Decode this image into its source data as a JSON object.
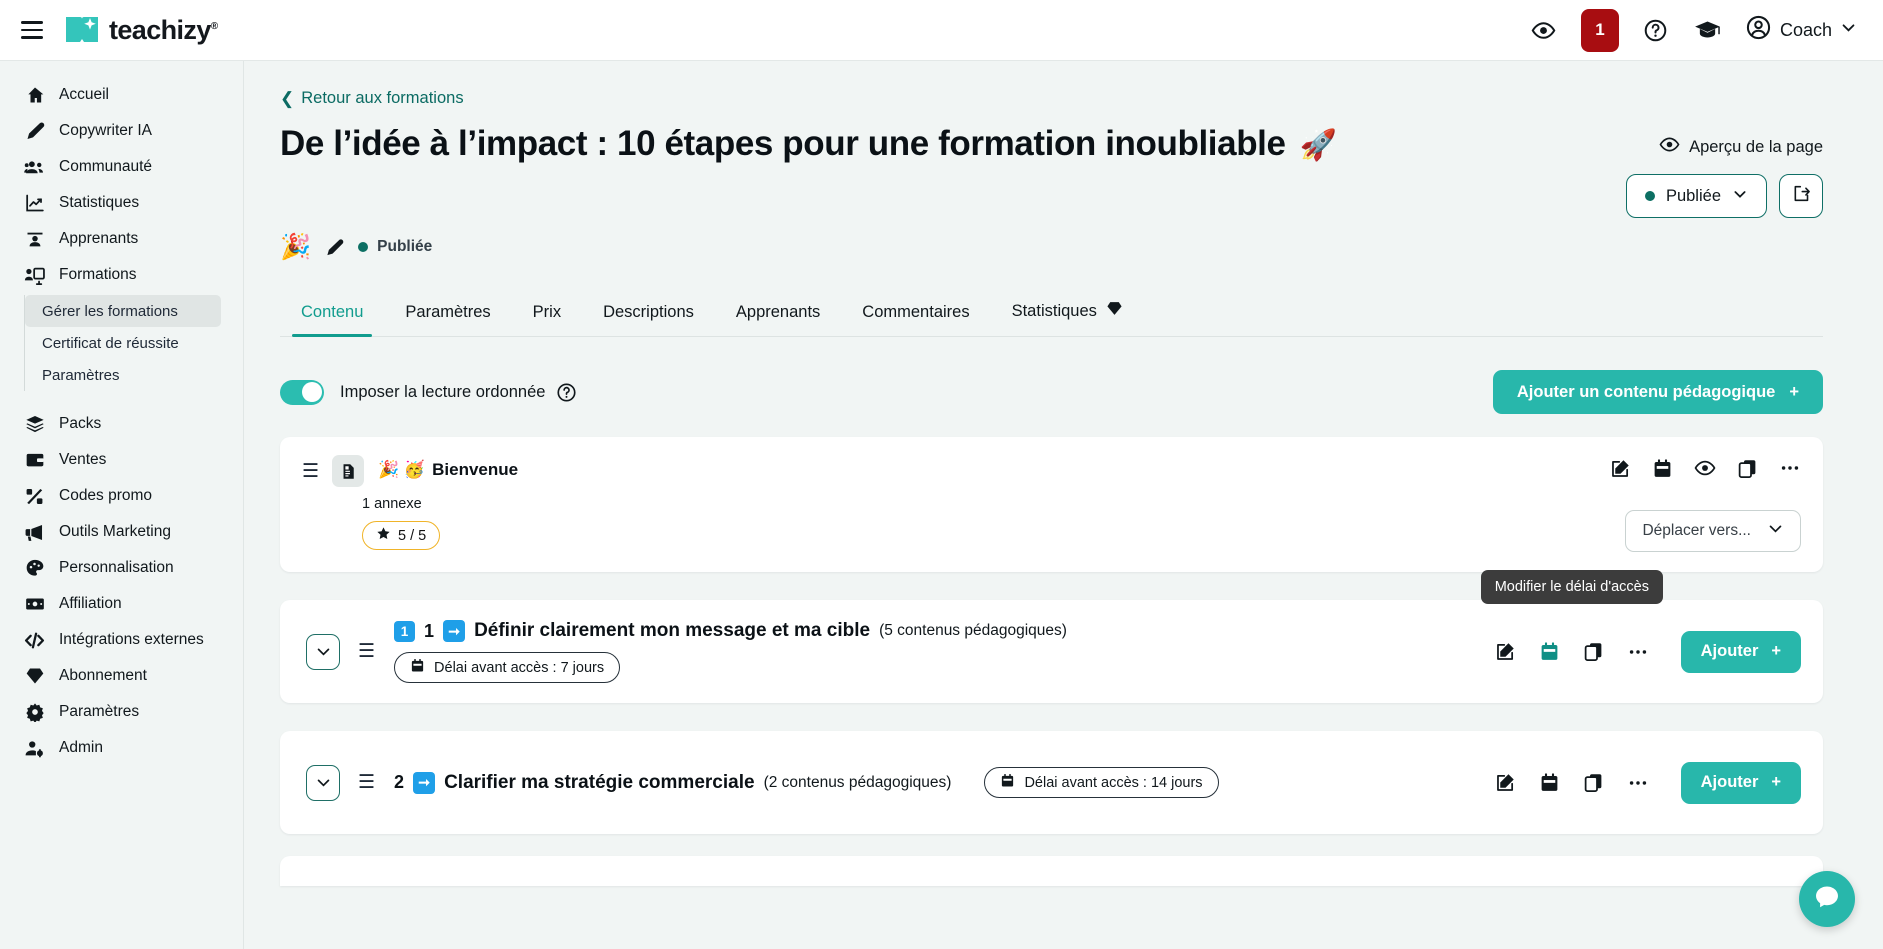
{
  "topbar": {
    "brand": "teachizy",
    "brand_sup": "®",
    "menu_icon": "hamburger-icon",
    "preview_icon": "eye-icon",
    "notifications_count": "1",
    "help_icon": "question-circle-icon",
    "academy_icon": "graduation-cap-icon",
    "user_name": "Coach"
  },
  "sidebar": {
    "items": [
      {
        "label": "Accueil",
        "icon": "home-icon"
      },
      {
        "label": "Copywriter IA",
        "icon": "pen-icon"
      },
      {
        "label": "Communauté",
        "icon": "users-icon"
      },
      {
        "label": "Statistiques",
        "icon": "chart-line-icon"
      },
      {
        "label": "Apprenants",
        "icon": "student-icon"
      },
      {
        "label": "Formations",
        "icon": "presentation-icon"
      }
    ],
    "sub_items": [
      {
        "label": "Gérer les formations",
        "active": true
      },
      {
        "label": "Certificat de réussite",
        "active": false
      },
      {
        "label": "Paramètres",
        "active": false
      }
    ],
    "items_after": [
      {
        "label": "Packs",
        "icon": "layers-icon"
      },
      {
        "label": "Ventes",
        "icon": "wallet-icon"
      },
      {
        "label": "Codes promo",
        "icon": "percent-icon"
      },
      {
        "label": "Outils Marketing",
        "icon": "megaphone-icon"
      },
      {
        "label": "Personnalisation",
        "icon": "palette-icon"
      },
      {
        "label": "Affiliation",
        "icon": "banknote-icon"
      },
      {
        "label": "Intégrations externes",
        "icon": "code-icon"
      },
      {
        "label": "Abonnement",
        "icon": "diamond-icon"
      },
      {
        "label": "Paramètres",
        "icon": "gear-icon"
      },
      {
        "label": "Admin",
        "icon": "user-gear-icon"
      }
    ]
  },
  "page": {
    "back_link": "Retour aux formations",
    "title": "De l’idée à l’impact : 10 étapes pour une formation inoubliable",
    "title_emoji": "🚀",
    "status_emoji": "🎉",
    "status_label": "Publiée",
    "edit_icon": "pencil-icon",
    "preview_page_label": "Aperçu de la page",
    "publish_state": "Publiée",
    "share_icon": "share-icon",
    "chevron_icon": "chevron-down-icon"
  },
  "tabs": [
    {
      "label": "Contenu",
      "active": true
    },
    {
      "label": "Paramètres",
      "active": false
    },
    {
      "label": "Prix",
      "active": false
    },
    {
      "label": "Descriptions",
      "active": false
    },
    {
      "label": "Apprenants",
      "active": false
    },
    {
      "label": "Commentaires",
      "active": false
    },
    {
      "label": "Statistiques",
      "active": false,
      "badge_icon": "diamond-icon"
    }
  ],
  "toolbar": {
    "toggle_label": "Imposer la lecture ordonnée",
    "toggle_on": true,
    "help_icon": "question-circle-icon",
    "add_content_label": "Ajouter un contenu pédagogique",
    "add_content_plus": "+"
  },
  "lesson_card": {
    "grip_icon": "drag-handle-icon",
    "type_icon": "document-icon",
    "emoji": "🎉 🥳",
    "title": "Bienvenue",
    "subtitle": "1 annexe",
    "score": "5 / 5",
    "score_icon": "star-icon",
    "actions": [
      {
        "icon": "edit-square-icon",
        "name": "edit-lesson"
      },
      {
        "icon": "calendar-icon",
        "name": "schedule-lesson"
      },
      {
        "icon": "eye-icon",
        "name": "preview-lesson"
      },
      {
        "icon": "copy-icon",
        "name": "duplicate-lesson"
      },
      {
        "icon": "ellipsis-icon",
        "name": "more-lesson"
      }
    ],
    "move_label": "Déplacer vers...",
    "move_chevron": "chevron-down-icon"
  },
  "sections": [
    {
      "chevron": "chevron-down-icon",
      "grip_icon": "drag-handle-icon",
      "badge_number": "1",
      "number": "1",
      "arrow_icon": "arrow-right-icon",
      "title": "Définir clairement mon message et ma cible",
      "count": "(5 contenus pédagogiques)",
      "delay_label": "Délai avant accès : 7 jours",
      "delay_icon": "calendar-icon",
      "delay_inline": false,
      "add_label": "Ajouter",
      "add_plus": "+",
      "actions": [
        {
          "icon": "edit-square-icon",
          "name": "edit-section"
        },
        {
          "icon": "calendar-icon",
          "name": "delay-section",
          "highlighted": true
        },
        {
          "icon": "copy-icon",
          "name": "duplicate-section"
        },
        {
          "icon": "ellipsis-icon",
          "name": "more-section"
        }
      ]
    },
    {
      "chevron": "chevron-down-icon",
      "grip_icon": "drag-handle-icon",
      "badge_number": "",
      "number": "2",
      "arrow_icon": "arrow-right-icon",
      "title": "Clarifier ma stratégie commerciale",
      "count": "(2 contenus pédagogiques)",
      "delay_label": "Délai avant accès : 14 jours",
      "delay_icon": "calendar-icon",
      "delay_inline": true,
      "add_label": "Ajouter",
      "add_plus": "+",
      "actions": [
        {
          "icon": "edit-square-icon",
          "name": "edit-section"
        },
        {
          "icon": "calendar-icon",
          "name": "delay-section"
        },
        {
          "icon": "copy-icon",
          "name": "duplicate-section"
        },
        {
          "icon": "ellipsis-icon",
          "name": "more-section"
        }
      ]
    }
  ],
  "tooltip": {
    "text": "Modifier le délai d'accès"
  },
  "chat": {
    "icon": "chat-icon"
  },
  "colors": {
    "accent": "#28b7ab",
    "teal_dark": "#0b6b63",
    "badge_red": "#a80d11",
    "blue": "#1f9fe8",
    "star_yellow": "#f0b429",
    "bg": "#f1f5f4"
  }
}
